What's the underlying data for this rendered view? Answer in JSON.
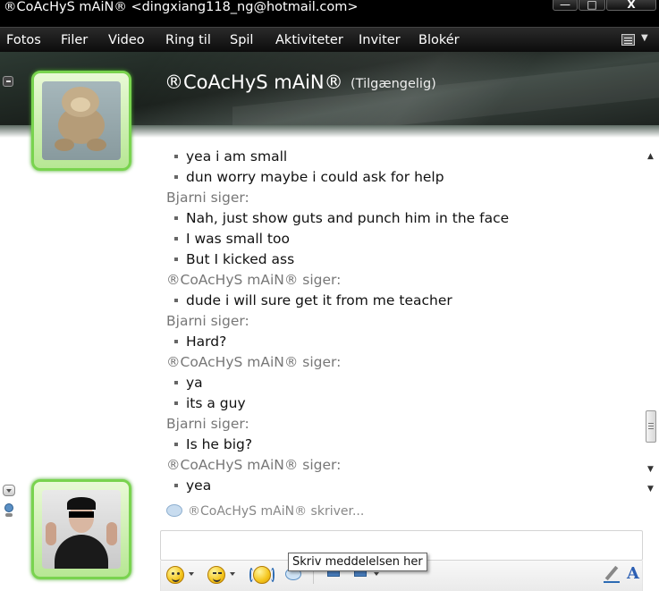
{
  "window": {
    "title": "®CoAcHyS mAiN® <dingxiang118_ng@hotmail.com>",
    "min_icon": "minimize-icon",
    "max_icon": "maximize-icon",
    "close_icon": "close-icon",
    "min_glyph": "—",
    "max_glyph": "□",
    "close_glyph": "X"
  },
  "menu": {
    "items": [
      "Fotos",
      "Filer",
      "Video",
      "Ring til",
      "Spil",
      "Aktiviteter",
      "Inviter",
      "Blokér"
    ],
    "options_icon": "options-menu-icon"
  },
  "header": {
    "contact_name": "®CoAcHyS mAiN®",
    "contact_status": "(Tilgængelig)"
  },
  "conversation": {
    "lines": [
      {
        "type": "item",
        "text": "yea i am small"
      },
      {
        "type": "item",
        "text": "dun worry maybe i could ask for help"
      },
      {
        "type": "sender",
        "text": "Bjarni siger:"
      },
      {
        "type": "item",
        "text": "Nah, just show guts and punch him in the face"
      },
      {
        "type": "item",
        "text": "I was small too"
      },
      {
        "type": "item",
        "text": "But I kicked ass"
      },
      {
        "type": "sender",
        "text": "®CoAcHyS mAiN® siger:"
      },
      {
        "type": "item",
        "text": "dude i will sure get it from me teacher"
      },
      {
        "type": "sender",
        "text": "Bjarni siger:"
      },
      {
        "type": "item",
        "text": "Hard?"
      },
      {
        "type": "sender",
        "text": "®CoAcHyS mAiN® siger:"
      },
      {
        "type": "item",
        "text": "ya"
      },
      {
        "type": "item",
        "text": "its a guy"
      },
      {
        "type": "sender",
        "text": "Bjarni siger:"
      },
      {
        "type": "item",
        "text": "Is he big?"
      },
      {
        "type": "sender",
        "text": "®CoAcHyS mAiN® siger:"
      },
      {
        "type": "item",
        "text": "yea"
      }
    ],
    "typing_status": "®CoAcHyS mAiN® skriver..."
  },
  "compose": {
    "tooltip": "Skriv meddelelsen her",
    "font_glyph": "A"
  },
  "scrollbar": {
    "up_glyph": "▲",
    "down_glyph": "▼",
    "end_glyph": "▼"
  }
}
